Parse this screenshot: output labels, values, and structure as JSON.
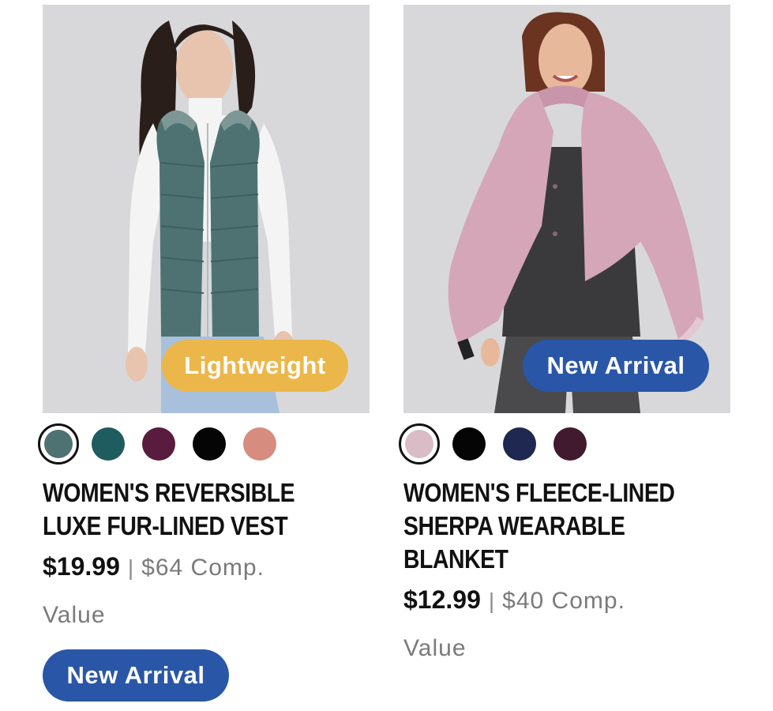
{
  "colors": {
    "badge_yellow": "#ecb74a",
    "badge_blue": "#2a56a8",
    "photo_bg": "#d8d8da"
  },
  "products": [
    {
      "image_badge": "Lightweight",
      "image_badge_color": "#ecb74a",
      "swatches": [
        {
          "color": "#4e7272",
          "selected": true
        },
        {
          "color": "#1e5c60",
          "selected": false
        },
        {
          "color": "#5a1c3e",
          "selected": false
        },
        {
          "color": "#050505",
          "selected": false
        },
        {
          "color": "#d68c7e",
          "selected": false
        }
      ],
      "title_line1": "WOMEN'S REVERSIBLE",
      "title_line2": "LUXE FUR-LINED VEST",
      "title_line3": "",
      "price": "$19.99",
      "separator": "|",
      "comp_price": "$64 Comp.",
      "value_label": "Value",
      "pill_label": "New Arrival",
      "pill_color": "#2a56a8"
    },
    {
      "image_badge": "New Arrival",
      "image_badge_color": "#2a56a8",
      "swatches": [
        {
          "color": "#d9bcc6",
          "selected": true
        },
        {
          "color": "#050505",
          "selected": false
        },
        {
          "color": "#1e2850",
          "selected": false
        },
        {
          "color": "#421a30",
          "selected": false
        }
      ],
      "title_line1": "WOMEN'S FLEECE-LINED",
      "title_line2": "SHERPA WEARABLE",
      "title_line3": "BLANKET",
      "price": "$12.99",
      "separator": "|",
      "comp_price": "$40 Comp.",
      "value_label": "Value"
    }
  ]
}
